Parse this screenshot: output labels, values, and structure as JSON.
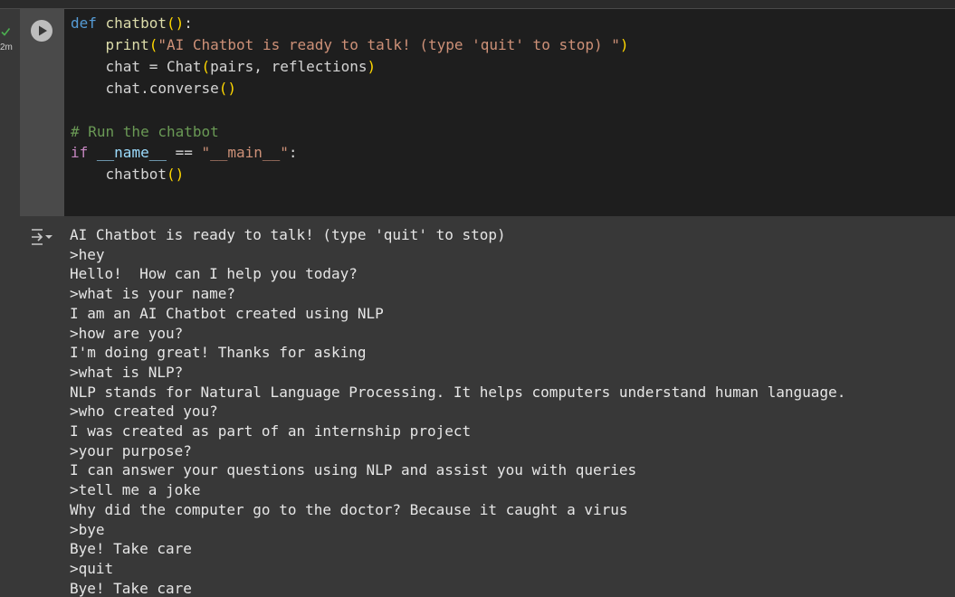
{
  "cell": {
    "exec_time": "2m",
    "code_lines": [
      [
        {
          "t": "def ",
          "c": "kw"
        },
        {
          "t": "chatbot",
          "c": "fn"
        },
        {
          "t": "()",
          "c": "br"
        },
        {
          "t": ":",
          "c": ""
        }
      ],
      [
        {
          "t": "    ",
          "c": ""
        },
        {
          "t": "print",
          "c": "fn"
        },
        {
          "t": "(",
          "c": "br"
        },
        {
          "t": "\"AI Chatbot is ready to talk! (type 'quit' to stop) \"",
          "c": "str"
        },
        {
          "t": ")",
          "c": "br"
        }
      ],
      [
        {
          "t": "    chat = Chat",
          "c": ""
        },
        {
          "t": "(",
          "c": "br"
        },
        {
          "t": "pairs, reflections",
          "c": ""
        },
        {
          "t": ")",
          "c": "br"
        }
      ],
      [
        {
          "t": "    chat.converse",
          "c": ""
        },
        {
          "t": "()",
          "c": "br"
        }
      ],
      [
        {
          "t": "",
          "c": ""
        }
      ],
      [
        {
          "t": "# Run the chatbot",
          "c": "cm"
        }
      ],
      [
        {
          "t": "if ",
          "c": "kw2"
        },
        {
          "t": "__name__",
          "c": "var"
        },
        {
          "t": " == ",
          "c": ""
        },
        {
          "t": "\"__main__\"",
          "c": "str"
        },
        {
          "t": ":",
          "c": ""
        }
      ],
      [
        {
          "t": "    chatbot",
          "c": ""
        },
        {
          "t": "()",
          "c": "br"
        }
      ]
    ]
  },
  "output": {
    "lines": [
      "AI Chatbot is ready to talk! (type 'quit' to stop)",
      ">hey",
      "Hello!  How can I help you today?",
      ">what is your name?",
      "I am an AI Chatbot created using NLP",
      ">how are you?",
      "I'm doing great! Thanks for asking",
      ">what is NLP?",
      "NLP stands for Natural Language Processing. It helps computers understand human language.",
      ">who created you?",
      "I was created as part of an internship project",
      ">your purpose?",
      "I can answer your questions using NLP and assist you with queries",
      ">tell me a joke",
      "Why did the computer go to the doctor? Because it caught a virus",
      ">bye",
      "Bye! Take care",
      ">quit",
      "Bye! Take care"
    ]
  },
  "icons": {
    "run": "play-icon",
    "status": "check-icon",
    "output_toggle": "output-collapse-icon"
  },
  "colors": {
    "editor_bg": "#1e1e1e",
    "output_bg": "#383838",
    "keyword": "#569cd6",
    "function": "#dcdcaa",
    "string": "#ce9178",
    "comment": "#6a9955",
    "bracket": "#ffd700",
    "success": "#4caf50"
  }
}
